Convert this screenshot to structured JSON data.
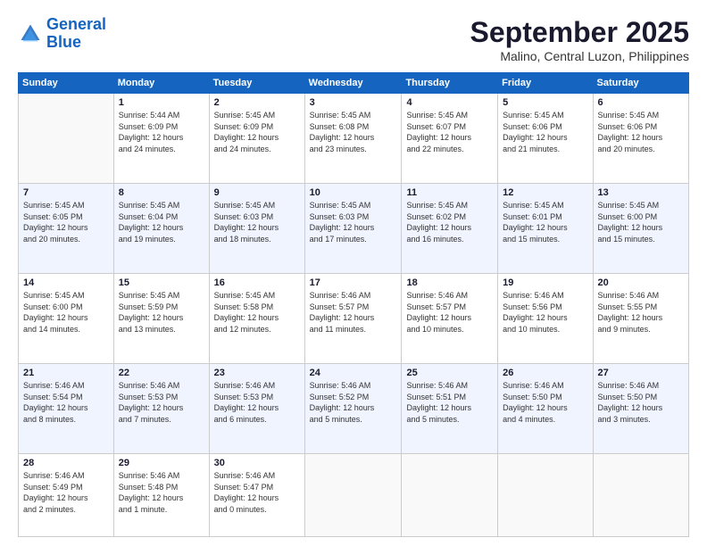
{
  "header": {
    "logo_line1": "General",
    "logo_line2": "Blue",
    "month": "September 2025",
    "location": "Malino, Central Luzon, Philippines"
  },
  "weekdays": [
    "Sunday",
    "Monday",
    "Tuesday",
    "Wednesday",
    "Thursday",
    "Friday",
    "Saturday"
  ],
  "weeks": [
    [
      {
        "day": "",
        "info": ""
      },
      {
        "day": "1",
        "info": "Sunrise: 5:44 AM\nSunset: 6:09 PM\nDaylight: 12 hours\nand 24 minutes."
      },
      {
        "day": "2",
        "info": "Sunrise: 5:45 AM\nSunset: 6:09 PM\nDaylight: 12 hours\nand 24 minutes."
      },
      {
        "day": "3",
        "info": "Sunrise: 5:45 AM\nSunset: 6:08 PM\nDaylight: 12 hours\nand 23 minutes."
      },
      {
        "day": "4",
        "info": "Sunrise: 5:45 AM\nSunset: 6:07 PM\nDaylight: 12 hours\nand 22 minutes."
      },
      {
        "day": "5",
        "info": "Sunrise: 5:45 AM\nSunset: 6:06 PM\nDaylight: 12 hours\nand 21 minutes."
      },
      {
        "day": "6",
        "info": "Sunrise: 5:45 AM\nSunset: 6:06 PM\nDaylight: 12 hours\nand 20 minutes."
      }
    ],
    [
      {
        "day": "7",
        "info": "Sunrise: 5:45 AM\nSunset: 6:05 PM\nDaylight: 12 hours\nand 20 minutes."
      },
      {
        "day": "8",
        "info": "Sunrise: 5:45 AM\nSunset: 6:04 PM\nDaylight: 12 hours\nand 19 minutes."
      },
      {
        "day": "9",
        "info": "Sunrise: 5:45 AM\nSunset: 6:03 PM\nDaylight: 12 hours\nand 18 minutes."
      },
      {
        "day": "10",
        "info": "Sunrise: 5:45 AM\nSunset: 6:03 PM\nDaylight: 12 hours\nand 17 minutes."
      },
      {
        "day": "11",
        "info": "Sunrise: 5:45 AM\nSunset: 6:02 PM\nDaylight: 12 hours\nand 16 minutes."
      },
      {
        "day": "12",
        "info": "Sunrise: 5:45 AM\nSunset: 6:01 PM\nDaylight: 12 hours\nand 15 minutes."
      },
      {
        "day": "13",
        "info": "Sunrise: 5:45 AM\nSunset: 6:00 PM\nDaylight: 12 hours\nand 15 minutes."
      }
    ],
    [
      {
        "day": "14",
        "info": "Sunrise: 5:45 AM\nSunset: 6:00 PM\nDaylight: 12 hours\nand 14 minutes."
      },
      {
        "day": "15",
        "info": "Sunrise: 5:45 AM\nSunset: 5:59 PM\nDaylight: 12 hours\nand 13 minutes."
      },
      {
        "day": "16",
        "info": "Sunrise: 5:45 AM\nSunset: 5:58 PM\nDaylight: 12 hours\nand 12 minutes."
      },
      {
        "day": "17",
        "info": "Sunrise: 5:46 AM\nSunset: 5:57 PM\nDaylight: 12 hours\nand 11 minutes."
      },
      {
        "day": "18",
        "info": "Sunrise: 5:46 AM\nSunset: 5:57 PM\nDaylight: 12 hours\nand 10 minutes."
      },
      {
        "day": "19",
        "info": "Sunrise: 5:46 AM\nSunset: 5:56 PM\nDaylight: 12 hours\nand 10 minutes."
      },
      {
        "day": "20",
        "info": "Sunrise: 5:46 AM\nSunset: 5:55 PM\nDaylight: 12 hours\nand 9 minutes."
      }
    ],
    [
      {
        "day": "21",
        "info": "Sunrise: 5:46 AM\nSunset: 5:54 PM\nDaylight: 12 hours\nand 8 minutes."
      },
      {
        "day": "22",
        "info": "Sunrise: 5:46 AM\nSunset: 5:53 PM\nDaylight: 12 hours\nand 7 minutes."
      },
      {
        "day": "23",
        "info": "Sunrise: 5:46 AM\nSunset: 5:53 PM\nDaylight: 12 hours\nand 6 minutes."
      },
      {
        "day": "24",
        "info": "Sunrise: 5:46 AM\nSunset: 5:52 PM\nDaylight: 12 hours\nand 5 minutes."
      },
      {
        "day": "25",
        "info": "Sunrise: 5:46 AM\nSunset: 5:51 PM\nDaylight: 12 hours\nand 5 minutes."
      },
      {
        "day": "26",
        "info": "Sunrise: 5:46 AM\nSunset: 5:50 PM\nDaylight: 12 hours\nand 4 minutes."
      },
      {
        "day": "27",
        "info": "Sunrise: 5:46 AM\nSunset: 5:50 PM\nDaylight: 12 hours\nand 3 minutes."
      }
    ],
    [
      {
        "day": "28",
        "info": "Sunrise: 5:46 AM\nSunset: 5:49 PM\nDaylight: 12 hours\nand 2 minutes."
      },
      {
        "day": "29",
        "info": "Sunrise: 5:46 AM\nSunset: 5:48 PM\nDaylight: 12 hours\nand 1 minute."
      },
      {
        "day": "30",
        "info": "Sunrise: 5:46 AM\nSunset: 5:47 PM\nDaylight: 12 hours\nand 0 minutes."
      },
      {
        "day": "",
        "info": ""
      },
      {
        "day": "",
        "info": ""
      },
      {
        "day": "",
        "info": ""
      },
      {
        "day": "",
        "info": ""
      }
    ]
  ]
}
